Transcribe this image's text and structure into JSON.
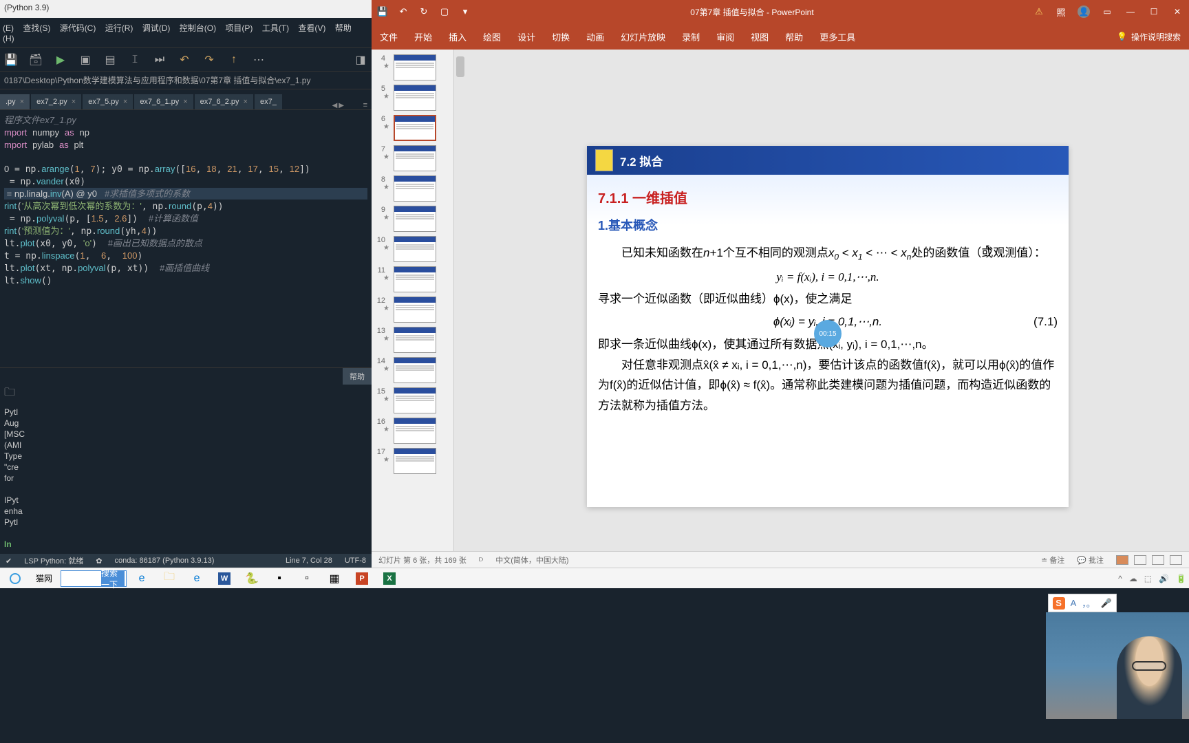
{
  "ide": {
    "title": "(Python 3.9)",
    "menu": [
      "(E)",
      "查找(S)",
      "源代码(C)",
      "运行(R)",
      "调试(D)",
      "控制台(O)",
      "项目(P)",
      "工具(T)",
      "查看(V)",
      "帮助(H)"
    ],
    "path": "0187\\Desktop\\Python数学建模算法与应用程序和数据\\07第7章  插值与拟合\\ex7_1.py",
    "tabs": [
      {
        "name": ".py",
        "active": true
      },
      {
        "name": "ex7_2.py",
        "active": false
      },
      {
        "name": "ex7_5.py",
        "active": false
      },
      {
        "name": "ex7_6_1.py",
        "active": false
      },
      {
        "name": "ex7_6_2.py",
        "active": false
      },
      {
        "name": "ex7_",
        "active": false
      }
    ],
    "code_header": "程序文件ex7_1.py",
    "console_lines": [
      "Pytl",
      "Aug",
      "[MSC",
      "(AMI",
      "Type",
      "\"cre",
      "for",
      "",
      "IPyt",
      "enha",
      "Pytl",
      "",
      "In "
    ],
    "help_btn": "帮助",
    "status": {
      "lsp": "LSP Python: 就绪",
      "conda": "conda: 86187 (Python 3.9.13)",
      "line": "Line 7, Col 28",
      "enc": "UTF-8"
    }
  },
  "ppt": {
    "doc_title": "07第7章 插值与拟合 - PowerPoint",
    "ribbon": [
      "文件",
      "开始",
      "插入",
      "绘图",
      "设计",
      "切换",
      "动画",
      "幻灯片放映",
      "录制",
      "审阅",
      "视图",
      "帮助",
      "更多工具"
    ],
    "search_hint": "操作说明搜索",
    "thumbs": [
      4,
      5,
      6,
      7,
      8,
      9,
      10,
      11,
      12,
      13,
      14,
      15,
      16,
      17
    ],
    "active_thumb": 6,
    "slide": {
      "header": "7.2 拟合",
      "section": "7.1.1 一维插值",
      "subtitle": "1.基本概念",
      "p1a": "已知未知函数在",
      "p1b": "个互不相同的观测点",
      "p1c": "处的函数值（或观测值）：",
      "formula1": "yᵢ = f(xᵢ),   i = 0,1,⋯,n.",
      "p2": "寻求一个近似函数（即近似曲线）ϕ(x)，使之满足",
      "formula2": "ϕ(xᵢ) = yᵢ,   i = 0,1,⋯,n.",
      "eq_num": "(7.1)",
      "p3": "即求一条近似曲线ϕ(x)，使其通过所有数据点(xᵢ, yᵢ), i = 0,1,⋯,n。",
      "p4": "对任意非观测点x̂(x̂ ≠ xᵢ, i = 0,1,⋯,n)，要估计该点的函数值f(x̂)，就可以用ϕ(x̂)的值作为f(x̂)的近似估计值，即ϕ(x̂) ≈ f(x̂)。通常称此类建模问题为插值问题，而构造近似函数的方法就称为插值方法。"
    },
    "timer": "00:15",
    "status": {
      "slide_info": "幻灯片 第 6 张，共 169 张",
      "lang": "中文(简体，中国大陆)",
      "backup": "备注",
      "comments": "批注"
    }
  },
  "ime": {
    "label_a": "A",
    "label_punct": "，。"
  },
  "taskbar": {
    "browser_tab": "猫网",
    "search_btn": "搜索一下"
  }
}
